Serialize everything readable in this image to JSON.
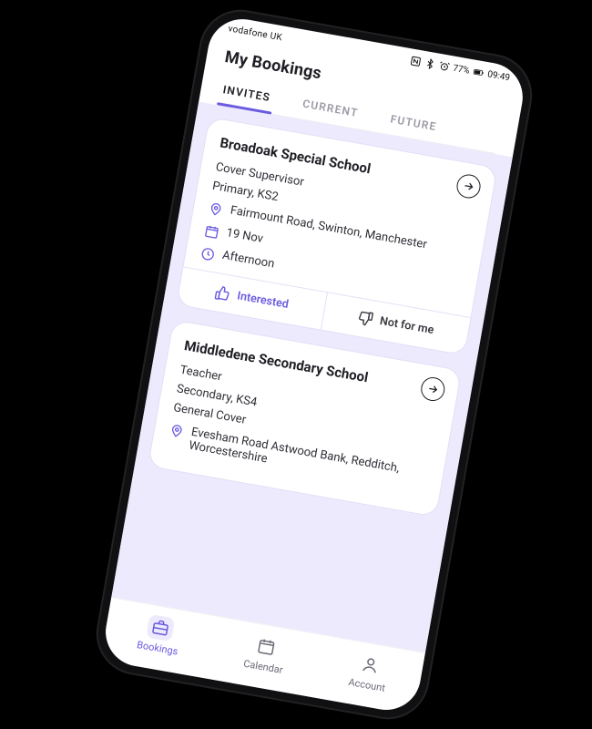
{
  "statusbar": {
    "carrier": "vodafone UK",
    "battery": "77%",
    "time": "09:49"
  },
  "header": {
    "title": "My Bookings"
  },
  "tabs": [
    {
      "key": "invites",
      "label": "INVITES",
      "active": true
    },
    {
      "key": "current",
      "label": "CURRENT",
      "active": false
    },
    {
      "key": "future",
      "label": "FUTURE",
      "active": false
    }
  ],
  "cards": [
    {
      "school": "Broadoak Special School",
      "role": "Cover Supervisor",
      "phase": "Primary, KS2",
      "address": "Fairmount Road, Swinton, Manchester",
      "date": "19 Nov",
      "slot": "Afternoon",
      "action_positive": "Interested",
      "action_negative": "Not for me"
    },
    {
      "school": "Middledene Secondary School",
      "role": "Teacher",
      "phase": "Secondary, KS4",
      "subject": "General Cover",
      "address": "Evesham Road Astwood Bank, Redditch, Worcestershire"
    }
  ],
  "bottomnav": [
    {
      "key": "bookings",
      "label": "Bookings",
      "active": true
    },
    {
      "key": "calendar",
      "label": "Calendar",
      "active": false
    },
    {
      "key": "account",
      "label": "Account",
      "active": false
    }
  ]
}
